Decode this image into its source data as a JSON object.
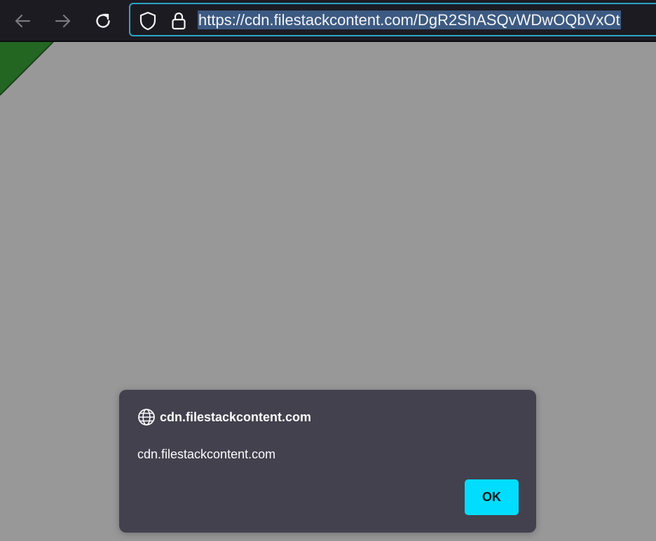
{
  "toolbar": {
    "back_icon": "back-arrow-icon",
    "forward_icon": "forward-arrow-icon",
    "reload_icon": "reload-icon",
    "shield_icon": "shield-icon",
    "lock_icon": "lock-icon"
  },
  "urlbar": {
    "url": "https://cdn.filestackcontent.com/DgR2ShASQvWDwOQbVxOt",
    "border_color": "#2aa7c7",
    "selection_color": "#3c5a82"
  },
  "page": {
    "background_color": "#989898",
    "corner_color": "#226622"
  },
  "dialog": {
    "icon": "globe-icon",
    "origin": "cdn.filestackcontent.com",
    "message": "cdn.filestackcontent.com",
    "ok_label": "OK",
    "background_color": "#42414d",
    "ok_color": "#00ddff"
  }
}
